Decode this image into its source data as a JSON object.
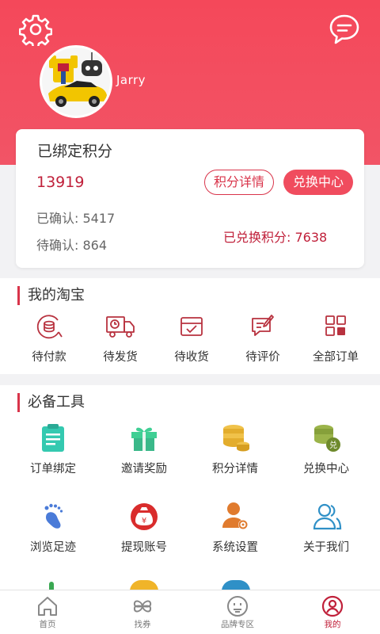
{
  "colors": {
    "brand": "#f4485a",
    "accent": "#c0203a",
    "tab_active": "#c0203a"
  },
  "header": {
    "settings_icon": "gear-icon",
    "message_icon": "chat-bubble-icon",
    "username": "Jarry"
  },
  "points_card": {
    "title": "已绑定积分",
    "points": "13919",
    "detail_button": "积分详情",
    "exchange_button": "兑换中心",
    "confirmed": "已确认: 5417",
    "pending": "待确认: 864",
    "exchanged": "已兑换积分: 7638"
  },
  "taobao": {
    "title": "我的淘宝",
    "items": [
      {
        "label": "待付款",
        "icon": "wallet-coins-icon"
      },
      {
        "label": "待发货",
        "icon": "delivery-truck-icon"
      },
      {
        "label": "待收货",
        "icon": "receive-box-icon"
      },
      {
        "label": "待评价",
        "icon": "review-icon"
      },
      {
        "label": "全部订单",
        "icon": "all-orders-grid-icon"
      }
    ]
  },
  "tools": {
    "title": "必备工具",
    "items": [
      {
        "label": "订单绑定",
        "icon": "clipboard-icon"
      },
      {
        "label": "邀请奖励",
        "icon": "gift-icon"
      },
      {
        "label": "积分详情",
        "icon": "coin-stack-icon"
      },
      {
        "label": "兑换中心",
        "icon": "exchange-coins-icon"
      },
      {
        "label": "浏览足迹",
        "icon": "footprint-icon"
      },
      {
        "label": "提现账号",
        "icon": "money-bag-icon"
      },
      {
        "label": "系统设置",
        "icon": "user-settings-icon"
      },
      {
        "label": "关于我们",
        "icon": "people-icon"
      }
    ]
  },
  "tabbar": {
    "items": [
      {
        "label": "首页",
        "icon": "home-icon",
        "active": false
      },
      {
        "label": "找券",
        "icon": "clover-icon",
        "active": false
      },
      {
        "label": "品牌专区",
        "icon": "brand-face-icon",
        "active": false
      },
      {
        "label": "我的",
        "icon": "profile-icon",
        "active": true
      }
    ]
  }
}
